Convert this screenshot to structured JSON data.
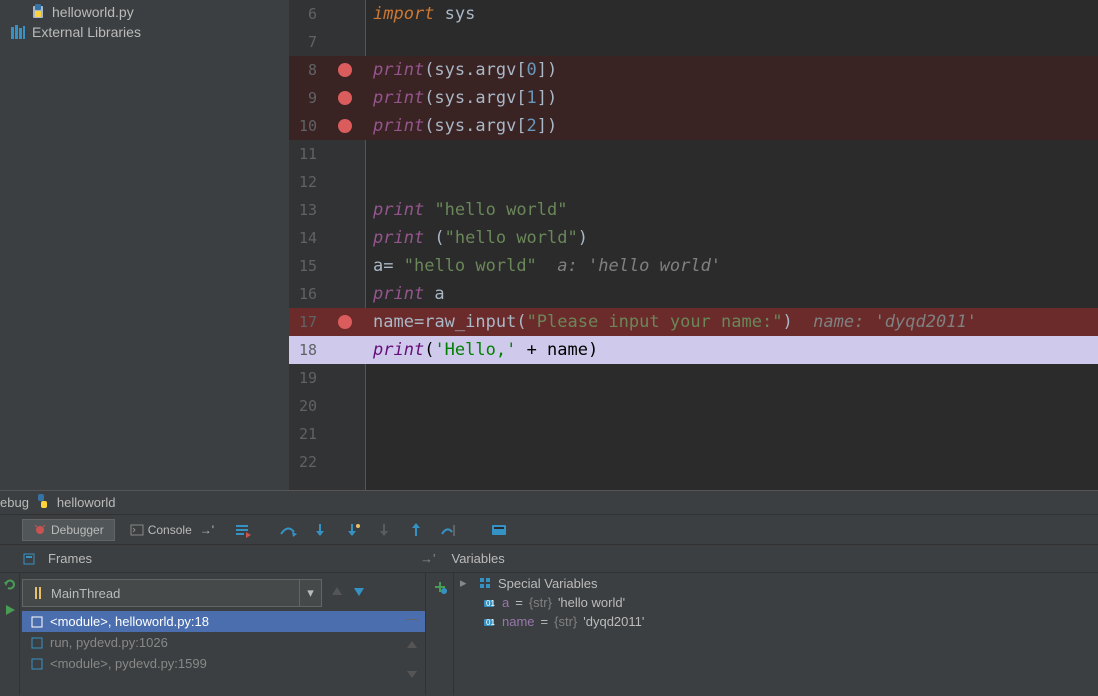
{
  "tree": {
    "file": "helloworld.py",
    "lib": "External Libraries"
  },
  "code": {
    "lines": [
      {
        "n": 6,
        "bp": false,
        "hl": "",
        "tokens": [
          [
            "kw",
            "import"
          ],
          [
            "op",
            " "
          ],
          [
            "op",
            "sys"
          ]
        ]
      },
      {
        "n": 7,
        "bp": false,
        "hl": "",
        "tokens": []
      },
      {
        "n": 8,
        "bp": true,
        "hl": "bp",
        "tokens": [
          [
            "fn",
            "print"
          ],
          [
            "op",
            "(sys.argv["
          ],
          [
            "num",
            "0"
          ],
          [
            "op",
            "])"
          ]
        ]
      },
      {
        "n": 9,
        "bp": true,
        "hl": "bp",
        "tokens": [
          [
            "fn",
            "print"
          ],
          [
            "op",
            "(sys.argv["
          ],
          [
            "num",
            "1"
          ],
          [
            "op",
            "])"
          ]
        ]
      },
      {
        "n": 10,
        "bp": true,
        "hl": "bp",
        "tokens": [
          [
            "fn",
            "print"
          ],
          [
            "op",
            "(sys.argv["
          ],
          [
            "num",
            "2"
          ],
          [
            "op",
            "])"
          ]
        ]
      },
      {
        "n": 11,
        "bp": false,
        "hl": "",
        "tokens": []
      },
      {
        "n": 12,
        "bp": false,
        "hl": "",
        "tokens": []
      },
      {
        "n": 13,
        "bp": false,
        "hl": "",
        "tokens": [
          [
            "fn",
            "print"
          ],
          [
            "op",
            " "
          ],
          [
            "str",
            "\"hello world\""
          ]
        ]
      },
      {
        "n": 14,
        "bp": false,
        "hl": "",
        "tokens": [
          [
            "fn",
            "print"
          ],
          [
            "op",
            " ("
          ],
          [
            "str",
            "\"hello world\""
          ],
          [
            "op",
            ")"
          ]
        ]
      },
      {
        "n": 15,
        "bp": false,
        "hl": "",
        "tokens": [
          [
            "op",
            "a"
          ],
          [
            "op",
            "= "
          ],
          [
            "str",
            "\"hello world\""
          ],
          [
            "op",
            "  "
          ],
          [
            "comment",
            "a: 'hello world'"
          ]
        ]
      },
      {
        "n": 16,
        "bp": false,
        "hl": "",
        "tokens": [
          [
            "fn",
            "print"
          ],
          [
            "op",
            " a"
          ]
        ]
      },
      {
        "n": 17,
        "bp": true,
        "hl": "exec",
        "tokens": [
          [
            "op",
            "name"
          ],
          [
            "op",
            "="
          ],
          [
            "op",
            "raw_input("
          ],
          [
            "str",
            "\"Please input your name:\""
          ],
          [
            "op",
            ")  "
          ],
          [
            "comment",
            "name: 'dyqd2011'"
          ]
        ]
      },
      {
        "n": 18,
        "bp": false,
        "hl": "cur",
        "tokens": [
          [
            "fn",
            "print"
          ],
          [
            "op",
            "("
          ],
          [
            "str",
            "'Hello,'"
          ],
          [
            "op",
            " + name)"
          ]
        ]
      },
      {
        "n": 19,
        "bp": false,
        "hl": "",
        "tokens": []
      },
      {
        "n": 20,
        "bp": false,
        "hl": "",
        "tokens": []
      },
      {
        "n": 21,
        "bp": false,
        "hl": "",
        "tokens": []
      },
      {
        "n": 22,
        "bp": false,
        "hl": "",
        "tokens": []
      }
    ]
  },
  "debug": {
    "header_prefix": "ebug",
    "target": "helloworld",
    "tab_debugger": "Debugger",
    "tab_console": "Console",
    "frames_label": "Frames",
    "vars_label": "Variables",
    "thread": "MainThread",
    "frames": [
      {
        "text": "<module>, helloworld.py:18",
        "selected": true
      },
      {
        "text": "run, pydevd.py:1026",
        "selected": false
      },
      {
        "text": "<module>, pydevd.py:1599",
        "selected": false
      }
    ],
    "special_vars": "Special Variables",
    "vars": [
      {
        "name": "a",
        "type": "{str}",
        "val": "'hello world'"
      },
      {
        "name": "name",
        "type": "{str}",
        "val": "'dyqd2011'"
      }
    ]
  }
}
